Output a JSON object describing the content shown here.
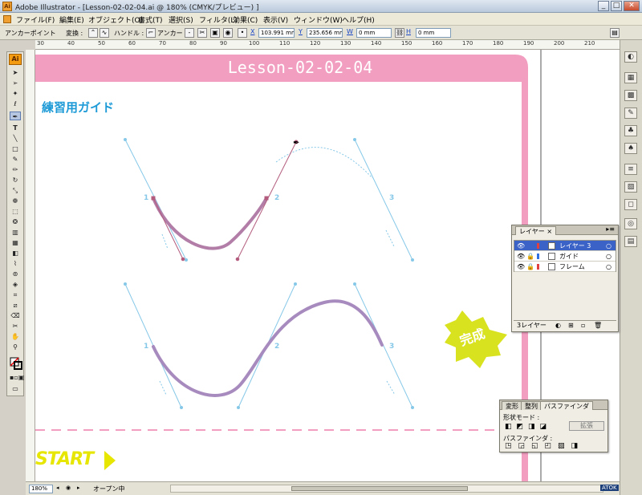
{
  "window": {
    "app_icon": "Ai",
    "title": "Adobe Illustrator - [Lesson-02-02-04.ai @ 180% (CMYK/プレビュー) ]",
    "minimize": "_",
    "maximize": "□",
    "close": "✕"
  },
  "menu": [
    "ファイル(F)",
    "編集(E)",
    "オブジェクト(O)",
    "書式(T)",
    "選択(S)",
    "フィルタ(L)",
    "効果(C)",
    "表示(V)",
    "ウィンドウ(W)",
    "ヘルプ(H)"
  ],
  "control": {
    "mode_label": "アンカーポイント",
    "convert_label": "変換 :",
    "handle_label": "ハンドル :",
    "anchor_label": "アンカー :",
    "x_label": "X",
    "x_value": "103.991 mm",
    "y_label": "Y",
    "y_value": "235.656 mm",
    "w_label": "W",
    "w_value": "0 mm",
    "h_label": "H",
    "h_value": "0 mm"
  },
  "ruler": {
    "top_ticks": [
      "30",
      "40",
      "50",
      "60",
      "70",
      "80",
      "90",
      "100",
      "110",
      "120",
      "130",
      "140",
      "150",
      "160",
      "170",
      "180",
      "190",
      "200",
      "210"
    ]
  },
  "artboard": {
    "banner": "Lesson-02-02-04",
    "heading": "練習用ガイド",
    "point_labels": [
      "1",
      "2",
      "3",
      "1",
      "2",
      "3"
    ],
    "done_badge": "完成",
    "start_text": "START",
    "banner_color": "#f29ec0",
    "heading_color": "#1e9bd7",
    "curve_color": "#a88bbe",
    "guide_color": "#86c8e8",
    "start_color": "#e6e600",
    "badge_color": "#d9e21f"
  },
  "layers_panel": {
    "tab": "レイヤー",
    "tab_close": "×",
    "layers": [
      {
        "name": "レイヤー 3",
        "color": "#e04040"
      },
      {
        "name": "ガイド",
        "color": "#3070e0"
      },
      {
        "name": "フレーム",
        "color": "#e04040"
      }
    ],
    "footer": "3レイヤー"
  },
  "pathfinder_panel": {
    "tabs": [
      "変形",
      "整列",
      "パスファインダ"
    ],
    "shape_modes_label": "形状モード :",
    "expand_label": "拡張",
    "pathfinders_label": "パスファインダ :"
  },
  "status": {
    "zoom": "180%",
    "state": "オープン中",
    "clock": "ATOK"
  }
}
